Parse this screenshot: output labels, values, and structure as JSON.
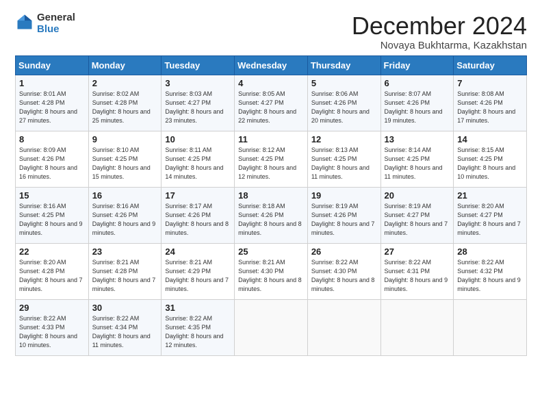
{
  "logo": {
    "general": "General",
    "blue": "Blue"
  },
  "header": {
    "month": "December 2024",
    "location": "Novaya Bukhtarma, Kazakhstan"
  },
  "days_of_week": [
    "Sunday",
    "Monday",
    "Tuesday",
    "Wednesday",
    "Thursday",
    "Friday",
    "Saturday"
  ],
  "weeks": [
    [
      {
        "day": "1",
        "sunrise": "8:01 AM",
        "sunset": "4:28 PM",
        "daylight": "8 hours and 27 minutes."
      },
      {
        "day": "2",
        "sunrise": "8:02 AM",
        "sunset": "4:28 PM",
        "daylight": "8 hours and 25 minutes."
      },
      {
        "day": "3",
        "sunrise": "8:03 AM",
        "sunset": "4:27 PM",
        "daylight": "8 hours and 23 minutes."
      },
      {
        "day": "4",
        "sunrise": "8:05 AM",
        "sunset": "4:27 PM",
        "daylight": "8 hours and 22 minutes."
      },
      {
        "day": "5",
        "sunrise": "8:06 AM",
        "sunset": "4:26 PM",
        "daylight": "8 hours and 20 minutes."
      },
      {
        "day": "6",
        "sunrise": "8:07 AM",
        "sunset": "4:26 PM",
        "daylight": "8 hours and 19 minutes."
      },
      {
        "day": "7",
        "sunrise": "8:08 AM",
        "sunset": "4:26 PM",
        "daylight": "8 hours and 17 minutes."
      }
    ],
    [
      {
        "day": "8",
        "sunrise": "8:09 AM",
        "sunset": "4:26 PM",
        "daylight": "8 hours and 16 minutes."
      },
      {
        "day": "9",
        "sunrise": "8:10 AM",
        "sunset": "4:25 PM",
        "daylight": "8 hours and 15 minutes."
      },
      {
        "day": "10",
        "sunrise": "8:11 AM",
        "sunset": "4:25 PM",
        "daylight": "8 hours and 14 minutes."
      },
      {
        "day": "11",
        "sunrise": "8:12 AM",
        "sunset": "4:25 PM",
        "daylight": "8 hours and 12 minutes."
      },
      {
        "day": "12",
        "sunrise": "8:13 AM",
        "sunset": "4:25 PM",
        "daylight": "8 hours and 11 minutes."
      },
      {
        "day": "13",
        "sunrise": "8:14 AM",
        "sunset": "4:25 PM",
        "daylight": "8 hours and 11 minutes."
      },
      {
        "day": "14",
        "sunrise": "8:15 AM",
        "sunset": "4:25 PM",
        "daylight": "8 hours and 10 minutes."
      }
    ],
    [
      {
        "day": "15",
        "sunrise": "8:16 AM",
        "sunset": "4:25 PM",
        "daylight": "8 hours and 9 minutes."
      },
      {
        "day": "16",
        "sunrise": "8:16 AM",
        "sunset": "4:26 PM",
        "daylight": "8 hours and 9 minutes."
      },
      {
        "day": "17",
        "sunrise": "8:17 AM",
        "sunset": "4:26 PM",
        "daylight": "8 hours and 8 minutes."
      },
      {
        "day": "18",
        "sunrise": "8:18 AM",
        "sunset": "4:26 PM",
        "daylight": "8 hours and 8 minutes."
      },
      {
        "day": "19",
        "sunrise": "8:19 AM",
        "sunset": "4:26 PM",
        "daylight": "8 hours and 7 minutes."
      },
      {
        "day": "20",
        "sunrise": "8:19 AM",
        "sunset": "4:27 PM",
        "daylight": "8 hours and 7 minutes."
      },
      {
        "day": "21",
        "sunrise": "8:20 AM",
        "sunset": "4:27 PM",
        "daylight": "8 hours and 7 minutes."
      }
    ],
    [
      {
        "day": "22",
        "sunrise": "8:20 AM",
        "sunset": "4:28 PM",
        "daylight": "8 hours and 7 minutes."
      },
      {
        "day": "23",
        "sunrise": "8:21 AM",
        "sunset": "4:28 PM",
        "daylight": "8 hours and 7 minutes."
      },
      {
        "day": "24",
        "sunrise": "8:21 AM",
        "sunset": "4:29 PM",
        "daylight": "8 hours and 7 minutes."
      },
      {
        "day": "25",
        "sunrise": "8:21 AM",
        "sunset": "4:30 PM",
        "daylight": "8 hours and 8 minutes."
      },
      {
        "day": "26",
        "sunrise": "8:22 AM",
        "sunset": "4:30 PM",
        "daylight": "8 hours and 8 minutes."
      },
      {
        "day": "27",
        "sunrise": "8:22 AM",
        "sunset": "4:31 PM",
        "daylight": "8 hours and 9 minutes."
      },
      {
        "day": "28",
        "sunrise": "8:22 AM",
        "sunset": "4:32 PM",
        "daylight": "8 hours and 9 minutes."
      }
    ],
    [
      {
        "day": "29",
        "sunrise": "8:22 AM",
        "sunset": "4:33 PM",
        "daylight": "8 hours and 10 minutes."
      },
      {
        "day": "30",
        "sunrise": "8:22 AM",
        "sunset": "4:34 PM",
        "daylight": "8 hours and 11 minutes."
      },
      {
        "day": "31",
        "sunrise": "8:22 AM",
        "sunset": "4:35 PM",
        "daylight": "8 hours and 12 minutes."
      },
      null,
      null,
      null,
      null
    ]
  ],
  "labels": {
    "sunrise": "Sunrise:",
    "sunset": "Sunset:",
    "daylight": "Daylight:"
  }
}
